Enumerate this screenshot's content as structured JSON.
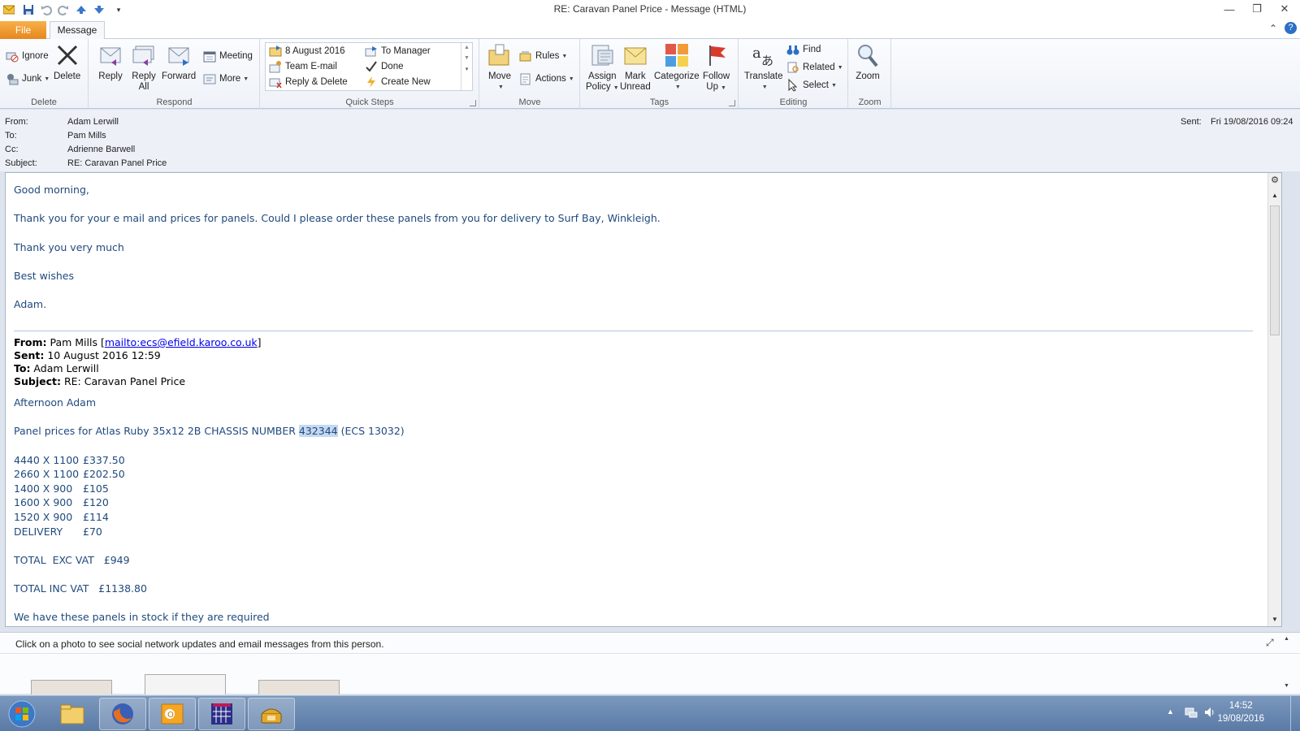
{
  "window": {
    "title": "RE: Caravan Panel Price  -  Message (HTML)"
  },
  "tabs": {
    "file": "File",
    "message": "Message"
  },
  "ribbon": {
    "delete_group": {
      "ignore": "Ignore",
      "junk": "Junk",
      "delete": "Delete",
      "label": "Delete"
    },
    "respond_group": {
      "reply": "Reply",
      "reply_all_1": "Reply",
      "reply_all_2": "All",
      "forward": "Forward",
      "meeting": "Meeting",
      "more": "More",
      "label": "Respond"
    },
    "quick_steps": {
      "items": [
        "8 August 2016",
        "Team E-mail",
        "Reply & Delete",
        "To Manager",
        "Done",
        "Create New"
      ],
      "label": "Quick Steps"
    },
    "move_group": {
      "move": "Move",
      "rules": "Rules",
      "actions": "Actions",
      "label": "Move"
    },
    "tags_group": {
      "assign_1": "Assign",
      "assign_2": "Policy",
      "mark_1": "Mark",
      "mark_2": "Unread",
      "categorize": "Categorize",
      "follow_1": "Follow",
      "follow_2": "Up",
      "label": "Tags"
    },
    "editing_group": {
      "translate": "Translate",
      "find": "Find",
      "related": "Related",
      "select": "Select",
      "label": "Editing"
    },
    "zoom_group": {
      "zoom": "Zoom",
      "label": "Zoom"
    }
  },
  "header": {
    "from_label": "From:",
    "from": "Adam Lerwill",
    "to_label": "To:",
    "to": "Pam Mills",
    "cc_label": "Cc:",
    "cc": "Adrienne Barwell",
    "subject_label": "Subject:",
    "subject": "RE: Caravan Panel Price",
    "sent_label": "Sent:",
    "sent": "Fri 19/08/2016 09:24"
  },
  "body": {
    "greeting": "Good morning,",
    "line1": "Thank you for your e mail and prices for panels.  Could I please order these panels from you for delivery to Surf Bay, Winkleigh.",
    "line2": "Thank you very much",
    "line3": "Best wishes",
    "line4": "Adam.",
    "quoted": {
      "from_label": "From:",
      "from_name": " Pam Mills [",
      "from_link": "mailto:ecs@efield.karoo.co.uk",
      "from_close": "]",
      "sent_label": "Sent:",
      "sent": " 10 August 2016 12:59",
      "to_label": "To:",
      "to": " Adam Lerwill",
      "subject_label": "Subject:",
      "subject": " RE: Caravan Panel Price"
    },
    "afternoon": "Afternoon Adam",
    "panel_prefix": "Panel prices for Atlas Ruby 35x12 2B CHASSIS NUMBER ",
    "panel_chassis": "432344",
    "panel_suffix": " (ECS 13032)",
    "prices": [
      {
        "size": "4440 X 1100",
        "price": "£337.50"
      },
      {
        "size": "2660 X 1100",
        "price": "£202.50"
      },
      {
        "size": "1400 X 900",
        "price": "£105"
      },
      {
        "size": "1600 X 900",
        "price": "£120"
      },
      {
        "size": "1520 X 900",
        "price": "£114"
      },
      {
        "size": "DELIVERY",
        "price": "£70"
      }
    ],
    "total_exc": "TOTAL  EXC VAT   £949",
    "total_inc": "TOTAL INC VAT   £1138.80",
    "cut_line": "We have these panels in stock if they are required"
  },
  "people_pane": {
    "hint": "Click on a photo to see social network updates and email messages from this person."
  },
  "taskbar": {
    "time": "14:52",
    "date": "19/08/2016"
  },
  "colors": {
    "body_text": "#1f497d",
    "file_tab": "#e6871d",
    "taskbar": "#5a7aa6"
  }
}
